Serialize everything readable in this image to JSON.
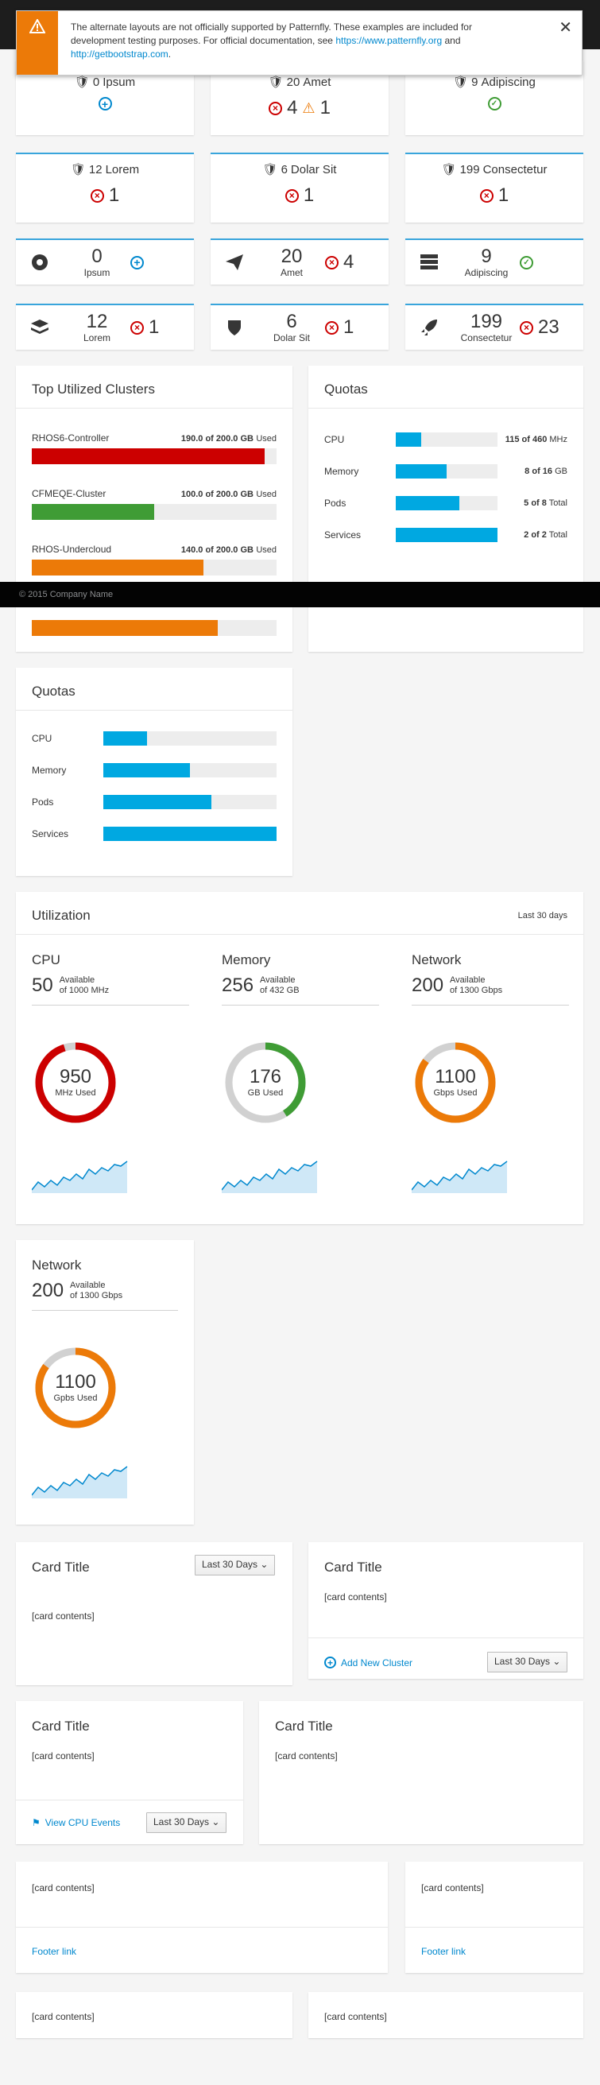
{
  "notification": {
    "text_a": "The alternate layouts are not officially supported by Patternfly. These examples are included for development testing purposes. For official documentation, see ",
    "link1": "https://www.patternfly.org",
    "text_b": " and ",
    "link2": "http://getbootstrap.com",
    "text_c": ".",
    "close": "✕"
  },
  "aggregate_cards": [
    {
      "count": "0",
      "label": "Ipsum"
    },
    {
      "count": "20",
      "label": "Amet",
      "err": "4",
      "warn": "1"
    },
    {
      "count": "9",
      "label": "Adipiscing"
    },
    {
      "count": "12",
      "label": "Lorem",
      "err": "1"
    },
    {
      "count": "6",
      "label": "Dolar Sit",
      "err": "1"
    },
    {
      "count": "199",
      "label": "Consectetur",
      "err": "1"
    }
  ],
  "mini_cards": [
    {
      "count": "0",
      "label": "Ipsum",
      "icon": "rebel-icon"
    },
    {
      "count": "20",
      "label": "Amet",
      "icon": "paper-plane-icon",
      "err": "4"
    },
    {
      "count": "9",
      "label": "Adipiscing",
      "icon": "server-icon"
    },
    {
      "count": "12",
      "label": "Lorem",
      "icon": "layers-icon",
      "err": "1"
    },
    {
      "count": "6",
      "label": "Dolar Sit",
      "icon": "shield-icon",
      "err": "1"
    },
    {
      "count": "199",
      "label": "Consectetur",
      "icon": "rocket-icon",
      "err": "23"
    }
  ],
  "top_clusters": {
    "title": "Top Utilized Clusters",
    "rows": [
      {
        "name": "RHOS6-Controller",
        "used": "190.0 of 200.0 GB",
        "suffix": "Used",
        "pct": 95,
        "color": "#cc0000"
      },
      {
        "name": "CFMEQE-Cluster",
        "used": "100.0 of 200.0 GB",
        "suffix": "Used",
        "pct": 50,
        "color": "#3f9c35"
      },
      {
        "name": "RHOS-Undercloud",
        "used": "140.0 of 200.0 GB",
        "suffix": "Used",
        "pct": 70,
        "color": "#ec7a08"
      },
      {
        "name": "",
        "used": "",
        "suffix": "",
        "pct": 76,
        "color": "#ec7a08"
      }
    ]
  },
  "quotas_right": {
    "title": "Quotas",
    "rows": [
      {
        "name": "CPU",
        "value": "115 of 460",
        "unit": "MHz",
        "pct": 25
      },
      {
        "name": "Memory",
        "value": "8 of 16",
        "unit": "GB",
        "pct": 50
      },
      {
        "name": "Pods",
        "value": "5 of 8",
        "unit": "Total",
        "pct": 62.5
      },
      {
        "name": "Services",
        "value": "2 of 2",
        "unit": "Total",
        "pct": 100
      }
    ]
  },
  "footer_strip": "© 2015 Company Name",
  "quotas_left": {
    "title": "Quotas",
    "rows": [
      {
        "name": "CPU",
        "pct": 25
      },
      {
        "name": "Memory",
        "pct": 50
      },
      {
        "name": "Pods",
        "pct": 62.5
      },
      {
        "name": "Services",
        "pct": 100
      }
    ]
  },
  "utilization": {
    "title": "Utilization",
    "period": "Last 30 days",
    "sections": [
      {
        "name": "CPU",
        "avail": "50",
        "avail_lbl": "Available",
        "of": "of 1000 MHz",
        "used": "950",
        "used_lbl": "MHz Used",
        "pct": 95,
        "color": "#cc0000"
      },
      {
        "name": "Memory",
        "avail": "256",
        "avail_lbl": "Available",
        "of": "of 432 GB",
        "used": "176",
        "used_lbl": "GB Used",
        "pct": 41,
        "color": "#3f9c35"
      },
      {
        "name": "Network",
        "avail": "200",
        "avail_lbl": "Available",
        "of": "of 1300 Gbps",
        "used": "1100",
        "used_lbl": "Gbps Used",
        "pct": 85,
        "color": "#ec7a08"
      }
    ]
  },
  "network_card": {
    "name": "Network",
    "avail": "200",
    "avail_lbl": "Available",
    "of": "of 1300 Gbps",
    "used": "1100",
    "used_lbl": "Gpbs Used",
    "pct": 85,
    "color": "#ec7a08"
  },
  "cards": {
    "title": "Card Title",
    "contents": "[card contents]",
    "dropdown": "Last 30 Days",
    "add_cluster": "Add New Cluster",
    "view_events": "View CPU Events",
    "footer_link": "Footer link"
  }
}
